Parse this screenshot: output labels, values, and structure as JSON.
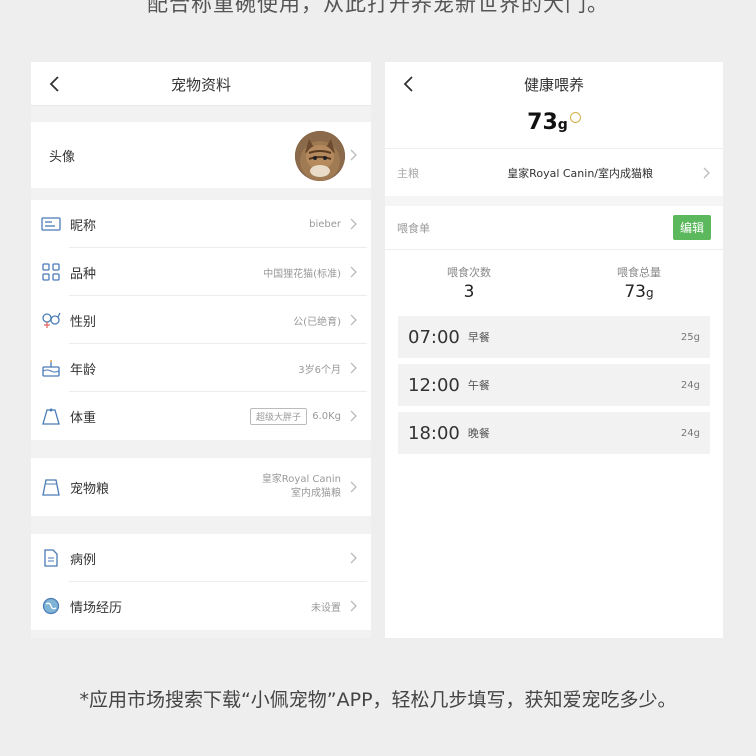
{
  "top_caption": "配合称重碗使用，从此打开养宠新世界的大门。",
  "left": {
    "title": "宠物资料",
    "avatar_label": "头像",
    "fields": [
      {
        "label": "昵称",
        "value": "bieber",
        "icon": "id-card-icon"
      },
      {
        "label": "品种",
        "value": "中国狸花猫(标准)",
        "icon": "grid-icon"
      },
      {
        "label": "性别",
        "value": "公(已绝育)",
        "icon": "gender-icon"
      },
      {
        "label": "年龄",
        "value": "3岁6个月",
        "icon": "cake-icon"
      },
      {
        "label": "体重",
        "value": "6.0Kg",
        "tag": "超级大胖子",
        "icon": "weight-icon"
      }
    ],
    "food": {
      "label": "宠物粮",
      "value_line1": "皇家Royal Canin",
      "value_line2": "室内成猫粮",
      "icon": "food-bag-icon"
    },
    "history": {
      "label": "病例",
      "value": "",
      "icon": "document-icon"
    },
    "experience": {
      "label": "情场经历",
      "value": "未设置",
      "icon": "globe-icon"
    }
  },
  "right": {
    "title": "健康喂养",
    "total_weight": "73",
    "total_unit": "g",
    "grain_label": "主粮",
    "grain_value": "皇家Royal Canin/室内成猫粮",
    "menu_label": "喂食单",
    "edit_label": "编辑",
    "count_label": "喂食次数",
    "count_value": "3",
    "amount_label": "喂食总量",
    "amount_value": "73",
    "amount_unit": "g",
    "meals": [
      {
        "time": "07:00",
        "name": "早餐",
        "amount": "25g"
      },
      {
        "time": "12:00",
        "name": "午餐",
        "amount": "24g"
      },
      {
        "time": "18:00",
        "name": "晚餐",
        "amount": "24g"
      }
    ]
  },
  "bottom_caption": "*应用市场搜索下载“小佩宠物”APP，轻松几步填写，获知爱宠吃多少。",
  "colors": {
    "accent_green": "#5cb85c",
    "icon_blue": "#4a7bb7"
  }
}
